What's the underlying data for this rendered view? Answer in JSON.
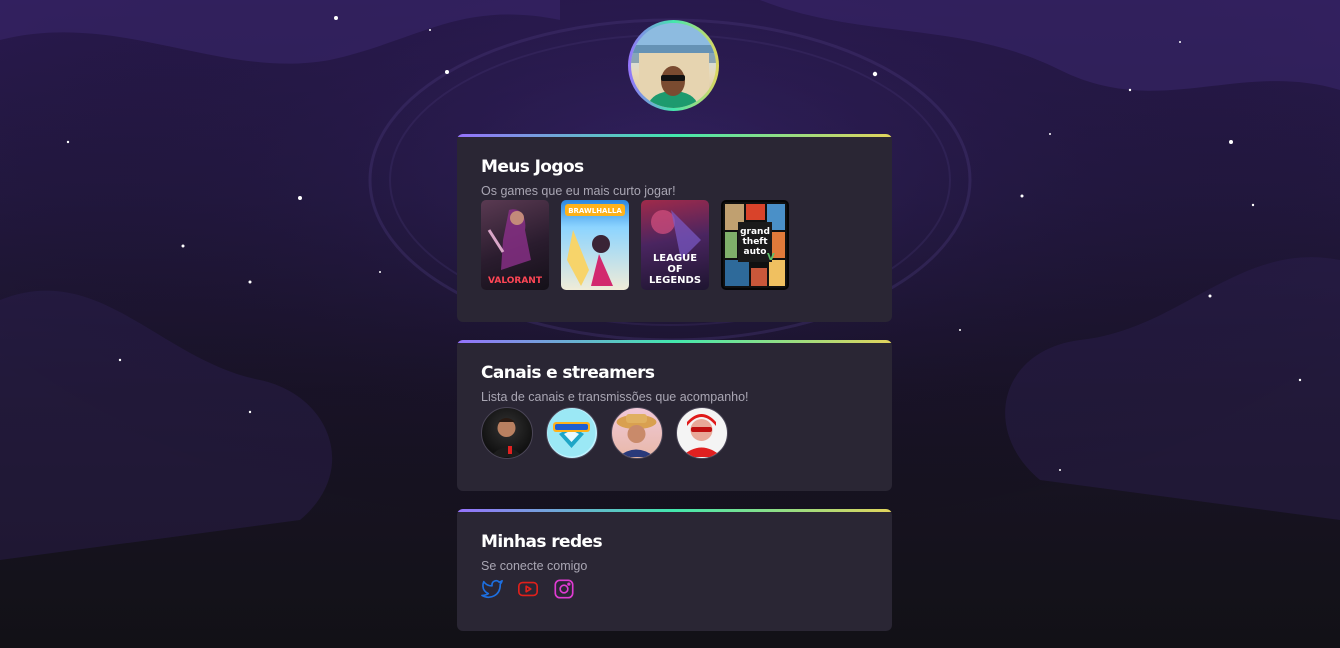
{
  "profile": {
    "avatar_alt": "Foto de perfil"
  },
  "games_card": {
    "title": "Meus Jogos",
    "subtitle": "Os games que eu mais curto jogar!",
    "games": [
      {
        "name": "VALORANT",
        "icon": "valorant-cover"
      },
      {
        "name": "BRAWLHALLA",
        "icon": "brawlhalla-cover"
      },
      {
        "name": "LEAGUE OF LEGENDS",
        "icon": "league-of-legends-cover"
      },
      {
        "name": "Grand Theft Auto V",
        "icon": "gta-v-cover"
      }
    ]
  },
  "streamers_card": {
    "title": "Canais e streamers",
    "subtitle": "Lista de canais e transmissões que acompanho!",
    "streamers": [
      {
        "icon": "streamer-1-avatar"
      },
      {
        "icon": "brawlhalla-channel-avatar"
      },
      {
        "icon": "streamer-3-avatar"
      },
      {
        "icon": "streamer-4-avatar"
      }
    ]
  },
  "social_card": {
    "title": "Minhas redes",
    "subtitle": "Se conecte comigo",
    "links": [
      {
        "icon": "twitter-icon",
        "color": "#1d6fe0"
      },
      {
        "icon": "youtube-icon",
        "color": "#e0201b"
      },
      {
        "icon": "instagram-icon",
        "color": "#e03bd2"
      }
    ]
  },
  "colors": {
    "card_bg": "#2a2634",
    "gradient": [
      "#9572fc",
      "#43e7ad",
      "#e2d45c"
    ],
    "subtitle": "#a9a6b3"
  }
}
